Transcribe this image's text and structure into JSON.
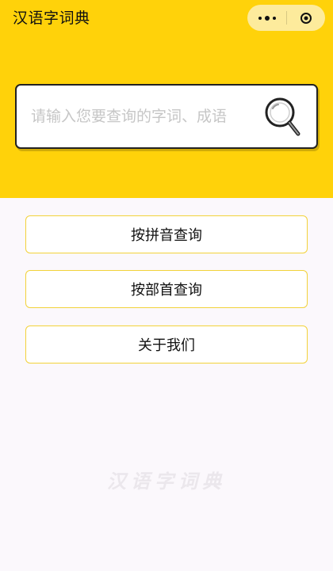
{
  "header": {
    "app_title": "汉语字词典",
    "background_color": "#ffd20a",
    "capsule": {
      "more_icon": "more-dots-icon",
      "close_icon": "target-circle-icon"
    }
  },
  "search": {
    "placeholder": "请输入您要查询的字词、成语",
    "value": "",
    "icon": "magnifier-icon"
  },
  "menu": {
    "items": [
      {
        "label": "按拼音查询"
      },
      {
        "label": "按部首查询"
      },
      {
        "label": "关于我们"
      }
    ],
    "border_color": "#f2d23a"
  },
  "footer": {
    "watermark": "汉语字词典"
  }
}
